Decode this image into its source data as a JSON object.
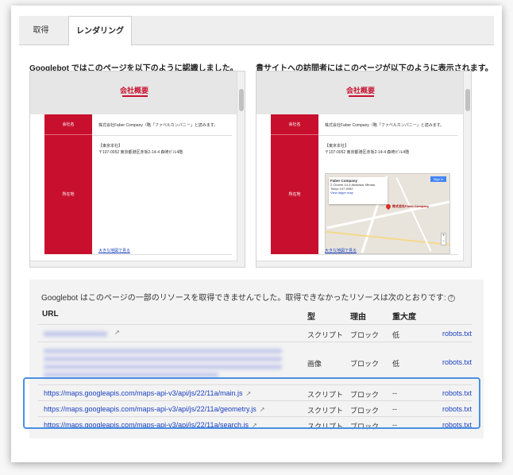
{
  "tabs": [
    {
      "label": "取得"
    },
    {
      "label": "レンダリング"
    }
  ],
  "render": {
    "googlebot_heading": "Googlebot ではこのページを以下のように認識しました。",
    "visitor_heading": "貴サイトへの訪問者にはこのページが以下のように表示されます。",
    "page_title": "会社概要",
    "row1_label": "会社名",
    "row1_text": "株式会社Faber Company（略「ファベルカンパニー」と読みます。",
    "row2_label": "所在地",
    "addr_head": "【東京本社】",
    "addr_line": "〒107-0052 東京都港区赤坂2-14-4 森崎ビル4階",
    "map_link": "大きな地図で見る",
    "map_card_title": "Faber Company",
    "map_card_line1": "2 Chome-14-4 Akasaka, Minato,",
    "map_card_line2": "Tokyo 107-0052",
    "map_card_link": "View larger map",
    "map_pin_label": "株式会社Faber Company",
    "map_signin": "Sign in"
  },
  "resources": {
    "note": "Googlebot はこのページの一部のリソースを取得できませんでした。取得できなかったリソースは次のとおりです:",
    "help_icon": "?",
    "headers": {
      "url": "URL",
      "type": "型",
      "reason": "理由",
      "severity": "重大度"
    },
    "rows": [
      {
        "url": "",
        "type": "スクリプト",
        "reason": "ブロック",
        "severity": "低",
        "robots": "robots.txt"
      },
      {
        "url": "",
        "type": "画像",
        "reason": "ブロック",
        "severity": "低",
        "robots": "robots.txt"
      },
      {
        "url": "https://maps.googleapis.com/maps-api-v3/api/js/22/11a/main.js",
        "type": "スクリプト",
        "reason": "ブロック",
        "severity": "--",
        "robots": "robots.txt"
      },
      {
        "url": "https://maps.googleapis.com/maps-api-v3/api/js/22/11a/geometry.js",
        "type": "スクリプト",
        "reason": "ブロック",
        "severity": "--",
        "robots": "robots.txt"
      },
      {
        "url": "https://maps.googleapis.com/maps-api-v3/api/js/22/11a/search.js",
        "type": "スクリプト",
        "reason": "ブロック",
        "severity": "--",
        "robots": "robots.txt"
      }
    ]
  },
  "colors": {
    "accent_red": "#c8102e",
    "link_blue": "#1a3fbf",
    "highlight": "#4a90e2"
  }
}
